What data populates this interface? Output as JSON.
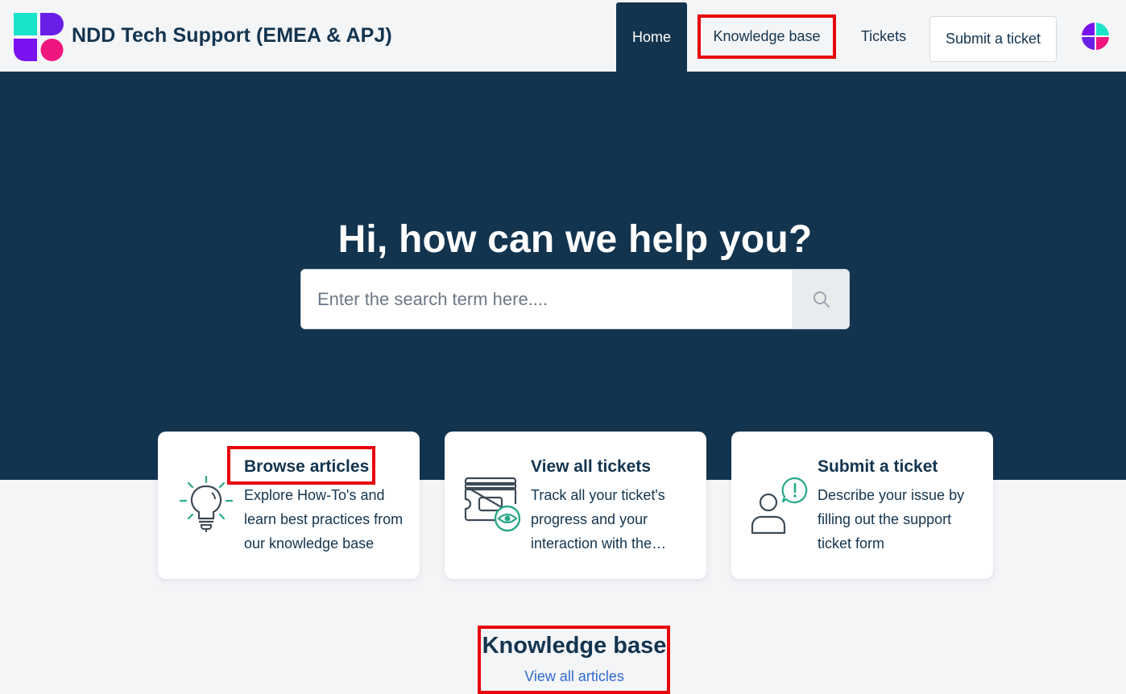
{
  "header": {
    "brand": "NDD Tech Support (EMEA & APJ)",
    "nav": {
      "home": "Home",
      "knowledge_base": "Knowledge base",
      "tickets": "Tickets",
      "submit_ticket": "Submit a ticket"
    },
    "logo_colors": [
      "#19e3c8",
      "#6a1fe8",
      "#7b13f0",
      "#f0167f"
    ],
    "avatar_icon": "user-avatar-icon"
  },
  "hero": {
    "title": "Hi, how can we help you?",
    "search": {
      "placeholder": "Enter the search term here....",
      "value": "",
      "button_icon": "search-icon"
    }
  },
  "cards": [
    {
      "title": "Browse articles",
      "description": "Explore How-To's and learn best practices from our knowledge base",
      "icon": "lightbulb-icon"
    },
    {
      "title": "View all tickets",
      "description": "Track all your ticket's progress and your interaction with the support team",
      "icon": "ticket-view-icon"
    },
    {
      "title": "Submit a ticket",
      "description": "Describe your issue by filling out the support ticket form",
      "icon": "user-alert-icon"
    }
  ],
  "knowledge_base": {
    "title": "Knowledge base",
    "link": "View all articles"
  },
  "colors": {
    "primary": "#13344f",
    "accent": "#2aa889",
    "link": "#2f6ccf",
    "highlight": "#e8000b"
  }
}
